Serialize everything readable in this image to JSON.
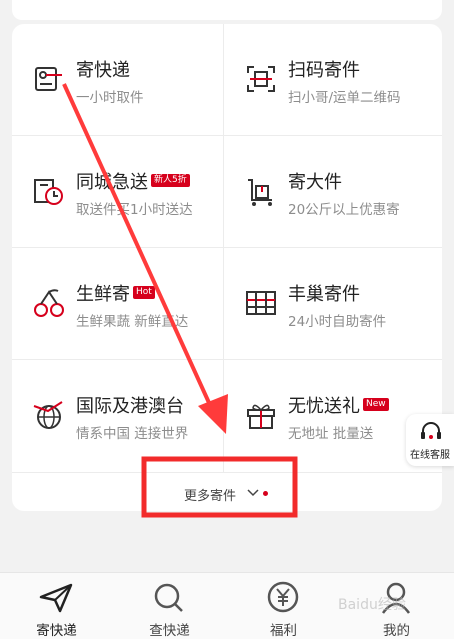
{
  "services": [
    {
      "title": "寄快递",
      "sub": "一小时取件",
      "icon": "parcel-send-icon"
    },
    {
      "title": "扫码寄件",
      "sub": "扫小哥/运单二维码",
      "icon": "scan-code-icon"
    },
    {
      "title": "同城急送",
      "sub": "取送件买1小时送达",
      "icon": "city-express-icon",
      "tag": "新人5折"
    },
    {
      "title": "寄大件",
      "sub": "20公斤以上优惠寄",
      "icon": "large-parcel-icon"
    },
    {
      "title": "生鲜寄",
      "sub": "生鲜果蔬 新鲜直达",
      "icon": "fresh-produce-icon",
      "tag": "Hot"
    },
    {
      "title": "丰巢寄件",
      "sub": "24小时自助寄件",
      "icon": "locker-icon"
    },
    {
      "title": "国际及港澳台",
      "sub": "情系中国 连接世界",
      "icon": "globe-plane-icon"
    },
    {
      "title": "无忧送礼",
      "sub": "无地址 批量送",
      "icon": "gift-icon",
      "tag": "New"
    }
  ],
  "more_label": "更多寄件",
  "customer_service": {
    "label": "在线客服",
    "icon": "headset-icon"
  },
  "tabs": [
    {
      "label": "寄快递",
      "icon": "paper-plane-icon",
      "active": true
    },
    {
      "label": "查快递",
      "icon": "search-icon",
      "active": false
    },
    {
      "label": "福利",
      "icon": "yen-coin-icon",
      "active": false
    },
    {
      "label": "我的",
      "icon": "user-icon",
      "active": false
    }
  ],
  "watermark": "Baidu经验",
  "accent_color": "#d6001c",
  "annotation_color": "#ff3b3b"
}
